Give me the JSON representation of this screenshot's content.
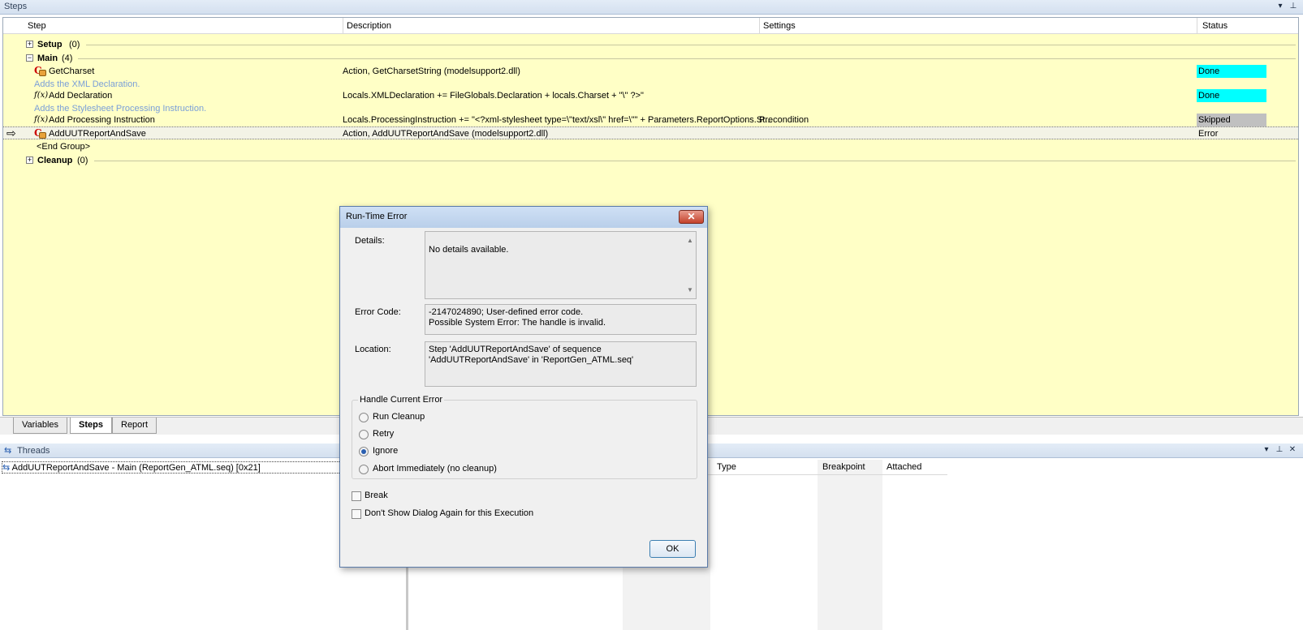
{
  "steps_pane": {
    "title": "Steps",
    "columns": [
      "Step",
      "Description",
      "Settings",
      "Status"
    ],
    "groups": {
      "setup": {
        "name": "Setup",
        "count": "(0)"
      },
      "main": {
        "name": "Main",
        "count": "(4)"
      },
      "cleanup": {
        "name": "Cleanup",
        "count": "(0)"
      }
    },
    "rows": [
      {
        "step": "GetCharset",
        "icon": "c-action-icon",
        "description": "Action,  GetCharsetString (modelsupport2.dll)",
        "settings": "",
        "status": "Done",
        "comment": "Adds the XML Declaration."
      },
      {
        "step": "Add Declaration",
        "icon": "fx-icon",
        "description": "Locals.XMLDeclaration += FileGlobals.Declaration + locals.Charset + \"\\\" ?>\"",
        "settings": "",
        "status": "Done",
        "comment": "Adds the Stylesheet Processing Instruction."
      },
      {
        "step": "Add Processing Instruction",
        "icon": "fx-icon",
        "description": "Locals.ProcessingInstruction += \"<?xml-stylesheet type=\\\"text/xsl\\\" href=\\\"\" + Parameters.ReportOptions.St...",
        "settings": "Precondition",
        "status": "Skipped",
        "comment": ""
      },
      {
        "step": "AddUUTReportAndSave",
        "icon": "c-action-icon",
        "description": "Action,  AddUUTReportAndSave (modelsupport2.dll)",
        "settings": "",
        "status": "Error",
        "comment": ""
      }
    ],
    "end_group": "<End Group>"
  },
  "tabs": [
    "Variables",
    "Steps",
    "Report"
  ],
  "threads_pane": {
    "title": "Threads",
    "thread_item": "AddUUTReportAndSave - Main (ReportGen_ATML.seq) [0x21]",
    "columns": [
      "Type",
      "Breakpoint",
      "Attached"
    ]
  },
  "dialog": {
    "title": "Run-Time Error",
    "close_glyph": "✕",
    "details_label": "Details:",
    "details_value": "No details available.",
    "error_code_label": "Error Code:",
    "error_code_value": "-2147024890; User-defined error code.\nPossible System Error: The handle is invalid.",
    "location_label": "Location:",
    "location_value": "Step 'AddUUTReportAndSave' of sequence\n'AddUUTReportAndSave' in 'ReportGen_ATML.seq'",
    "handle_group_label": "Handle Current Error",
    "options": [
      "Run Cleanup",
      "Retry",
      "Ignore",
      "Abort Immediately (no cleanup)"
    ],
    "selected_option": "Ignore",
    "break_label": "Break",
    "dont_show_label": "Don't Show Dialog Again for this Execution",
    "ok_label": "OK"
  },
  "colors": {
    "steps_bg": "#ffffc6",
    "done": "#00ffff",
    "skipped": "#c0c0c0",
    "comment": "#7a9fd8"
  }
}
